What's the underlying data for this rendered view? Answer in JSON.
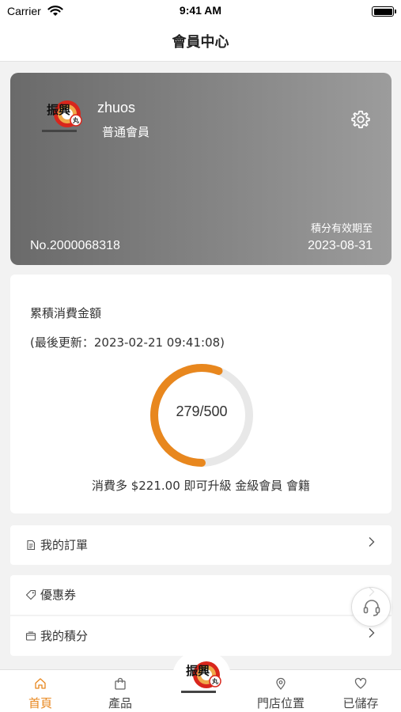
{
  "status_bar": {
    "carrier": "Carrier",
    "time": "9:41 AM"
  },
  "nav": {
    "title": "會員中心"
  },
  "member_card": {
    "username": "zhuos",
    "level": "普通會員",
    "card_no": "No.2000068318",
    "expiry_label": "積分有效期至",
    "expiry_date": "2023-08-31",
    "logo_text": "振興"
  },
  "spending": {
    "title": "累積消費金額",
    "updated": "(最後更新：2023-02-21 09:41:08)",
    "progress_text": "279/500",
    "current": 279,
    "target": 500,
    "upgrade_text": "消費多 $221.00 即可升級 金級會員 會籍",
    "progress_color": "#e8871e",
    "track_color": "#e8e8e8"
  },
  "menu": {
    "orders": "我的訂單",
    "coupons": "優惠券",
    "points": "我的積分"
  },
  "tabs": {
    "home": "首頁",
    "products": "產品",
    "stores": "門店位置",
    "saved": "已儲存",
    "active_color": "#e8871e"
  }
}
